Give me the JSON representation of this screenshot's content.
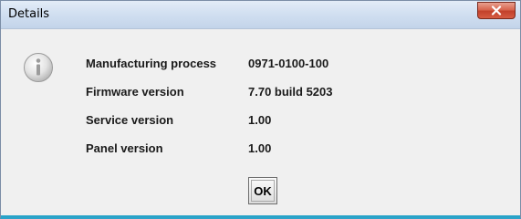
{
  "dialog": {
    "title": "Details",
    "close_icon": "close-icon",
    "info_icon": "info-icon"
  },
  "details": [
    {
      "label": "Manufacturing process",
      "value": "0971-0100-100"
    },
    {
      "label": "Firmware version",
      "value": "7.70 build 5203"
    },
    {
      "label": "Service version",
      "value": "1.00"
    },
    {
      "label": "Panel version",
      "value": "1.00"
    }
  ],
  "buttons": {
    "ok_label": "OK"
  },
  "colors": {
    "close_button": "#c2412b",
    "accent_border": "#27a3c8"
  }
}
